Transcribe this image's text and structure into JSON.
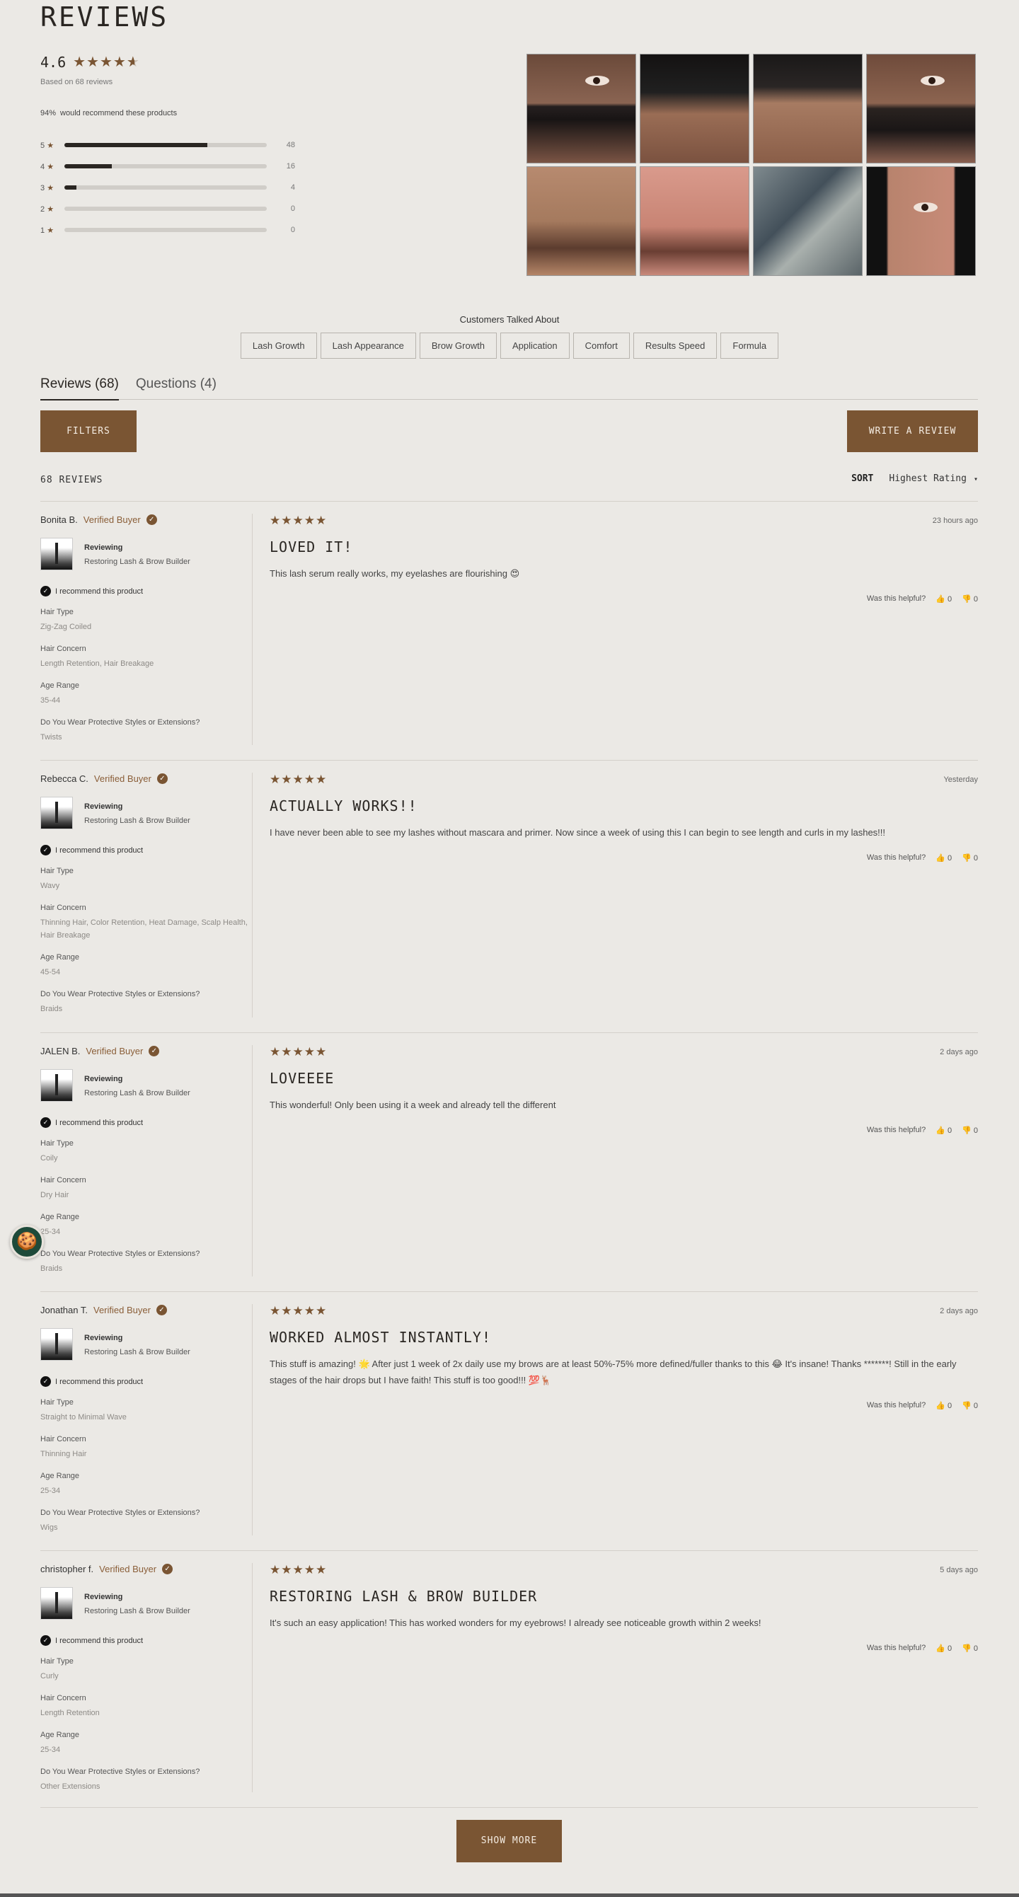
{
  "page": {
    "title": "REVIEWS"
  },
  "summary": {
    "average": "4.6",
    "stars": "★★★★",
    "partial_star": "★",
    "based_on": "Based on 68 reviews",
    "recommend_pct": "94%",
    "recommend_text": "would recommend these products",
    "histogram": [
      {
        "label": "5",
        "count": "48",
        "fraction": 0.706
      },
      {
        "label": "4",
        "count": "16",
        "fraction": 0.235
      },
      {
        "label": "3",
        "count": "4",
        "fraction": 0.059
      },
      {
        "label": "2",
        "count": "0",
        "fraction": 0
      },
      {
        "label": "1",
        "count": "0",
        "fraction": 0
      }
    ],
    "star_glyph": "★"
  },
  "topics": {
    "title": "Customers Talked About",
    "items": [
      "Lash Growth",
      "Lash Appearance",
      "Brow Growth",
      "Application",
      "Comfort",
      "Results Speed",
      "Formula"
    ]
  },
  "tabs": {
    "reviews": "Reviews (68)",
    "questions": "Questions (4)"
  },
  "actions": {
    "filters": "FILTERS",
    "write_review": "WRITE A REVIEW"
  },
  "list_header": {
    "count": "68 REVIEWS",
    "sort_label": "SORT",
    "sort_value": "Highest Rating",
    "caret": "▾"
  },
  "labels": {
    "verified": "Verified Buyer",
    "check": "✓",
    "reviewing": "Reviewing",
    "recommend": "I recommend this product",
    "thumbs": "👍",
    "helpful": "Was this helpful?",
    "up": "👍 0",
    "down": "👎 0",
    "stars": "★★★★★"
  },
  "reviews": [
    {
      "author": "Bonita B.",
      "date": "23 hours ago",
      "title": "LOVED IT!",
      "body": "This lash serum really works, my eyelashes are flourishing 😍",
      "product": "Restoring Lash & Brow Builder",
      "attrs": [
        {
          "k": "Hair Type",
          "v": "Zig-Zag Coiled"
        },
        {
          "k": "Hair Concern",
          "v": "Length Retention, Hair Breakage"
        },
        {
          "k": "Age Range",
          "v": "35-44"
        },
        {
          "k": "Do You Wear Protective Styles or Extensions?",
          "v": "Twists"
        }
      ]
    },
    {
      "author": "Rebecca C.",
      "date": "Yesterday",
      "title": "ACTUALLY WORKS!!",
      "body": "I have never been able to see my lashes without mascara and primer. Now since a week of using this I can begin to see length and curls in my lashes!!!",
      "product": "Restoring Lash & Brow Builder",
      "attrs": [
        {
          "k": "Hair Type",
          "v": "Wavy"
        },
        {
          "k": "Hair Concern",
          "v": "Thinning Hair, Color Retention, Heat Damage, Scalp Health, Hair Breakage"
        },
        {
          "k": "Age Range",
          "v": "45-54"
        },
        {
          "k": "Do You Wear Protective Styles or Extensions?",
          "v": "Braids"
        }
      ]
    },
    {
      "author": "JALEN B.",
      "date": "2 days ago",
      "title": "LOVEEEE",
      "body": "This wonderful! Only been using it a week and already tell the different",
      "product": "Restoring Lash & Brow Builder",
      "attrs": [
        {
          "k": "Hair Type",
          "v": "Coily"
        },
        {
          "k": "Hair Concern",
          "v": "Dry Hair"
        },
        {
          "k": "Age Range",
          "v": "25-34"
        },
        {
          "k": "Do You Wear Protective Styles or Extensions?",
          "v": "Braids"
        }
      ]
    },
    {
      "author": "Jonathan T.",
      "date": "2 days ago",
      "title": "WORKED ALMOST INSTANTLY!",
      "body": "This stuff is amazing! 🌟 After just 1 week of 2x daily use my brows are at least 50%-75% more defined/fuller thanks to this 😂 It's insane! Thanks *******! Still in the early stages of the hair drops but I have faith! This stuff is too good!!! 💯🦌",
      "product": "Restoring Lash & Brow Builder",
      "attrs": [
        {
          "k": "Hair Type",
          "v": "Straight to Minimal Wave"
        },
        {
          "k": "Hair Concern",
          "v": "Thinning Hair"
        },
        {
          "k": "Age Range",
          "v": "25-34"
        },
        {
          "k": "Do You Wear Protective Styles or Extensions?",
          "v": "Wigs"
        }
      ]
    },
    {
      "author": "christopher f.",
      "date": "5 days ago",
      "title": "RESTORING LASH & BROW BUILDER",
      "body": "It's such an easy application! This has worked wonders for my eyebrows! I already see noticeable growth within 2 weeks!",
      "product": "Restoring Lash & Brow Builder",
      "attrs": [
        {
          "k": "Hair Type",
          "v": "Curly"
        },
        {
          "k": "Hair Concern",
          "v": "Length Retention"
        },
        {
          "k": "Age Range",
          "v": "25-34"
        },
        {
          "k": "Do You Wear Protective Styles or Extensions?",
          "v": "Other Extensions"
        }
      ]
    }
  ],
  "show_more": "SHOW MORE",
  "cookie_icon": "🍪",
  "colors": {
    "accent": "#7a5533",
    "background": "#ebe9e5",
    "text": "#2a2622"
  }
}
